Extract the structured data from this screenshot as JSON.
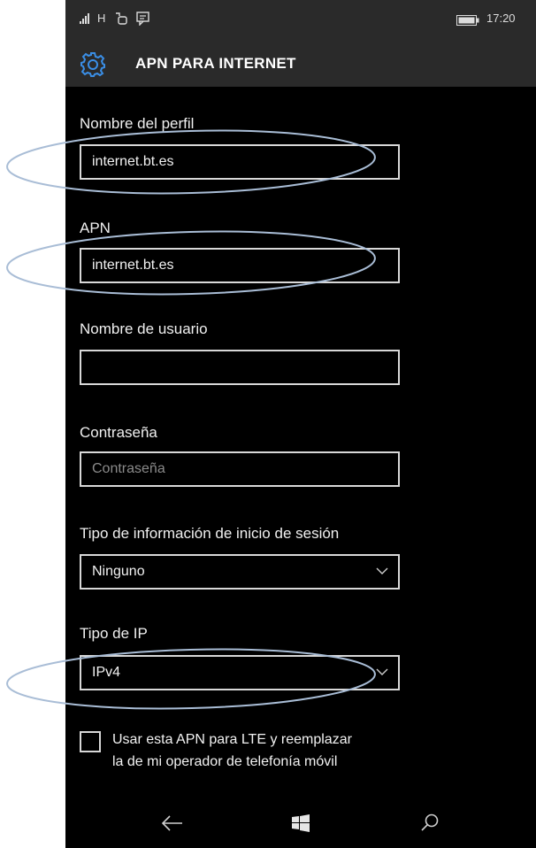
{
  "status_bar": {
    "signal_icon": "signal-bars-icon",
    "network_type": "H",
    "icons": [
      "roaming-icon",
      "message-icon"
    ],
    "battery_icon": "battery-icon",
    "time": "17:20"
  },
  "header": {
    "icon": "gear-icon",
    "title": "APN PARA INTERNET"
  },
  "form": {
    "profile_name": {
      "label": "Nombre del perfil",
      "value": "internet.bt.es"
    },
    "apn": {
      "label": "APN",
      "value": "internet.bt.es"
    },
    "username": {
      "label": "Nombre de usuario",
      "value": ""
    },
    "password": {
      "label": "Contraseña",
      "value": "",
      "placeholder": "Contraseña"
    },
    "login_info_type": {
      "label": "Tipo de información de inicio de sesión",
      "value": "Ninguno"
    },
    "ip_type": {
      "label": "Tipo de IP",
      "value": "IPv4"
    },
    "lte_checkbox": {
      "checked": false,
      "label_line1": "Usar esta APN para LTE y reemplazar",
      "label_line2": "la de mi operador de telefonía móvil"
    }
  },
  "nav_bar": {
    "back_icon": "back-arrow-icon",
    "home_icon": "windows-logo-icon",
    "search_icon": "search-icon"
  },
  "colors": {
    "background": "#000000",
    "header_bar": "#2a2a2a",
    "text": "#ffffff",
    "annotation_oval": "#a9bdd6"
  }
}
